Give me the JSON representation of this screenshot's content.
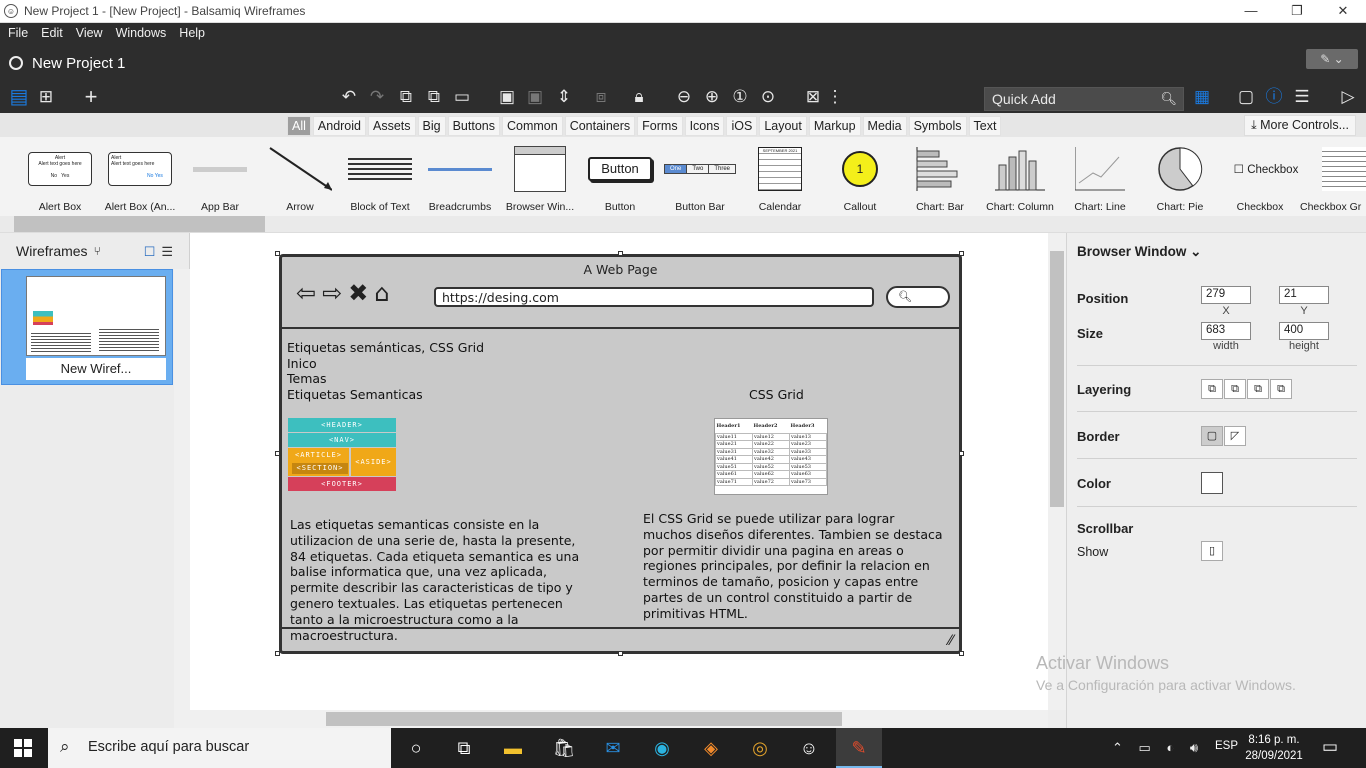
{
  "window": {
    "title": "New Project 1 - [New Project] - Balsamiq Wireframes",
    "controls": [
      "—",
      "❐",
      "✕"
    ]
  },
  "menu": [
    "File",
    "Edit",
    "View",
    "Windows",
    "Help"
  ],
  "project": {
    "name": "New Project 1"
  },
  "quick_add": {
    "placeholder": "Quick Add"
  },
  "categories": [
    "All",
    "Android",
    "Assets",
    "Big",
    "Buttons",
    "Common",
    "Containers",
    "Forms",
    "Icons",
    "iOS",
    "Layout",
    "Markup",
    "Media",
    "Symbols",
    "Text"
  ],
  "active_category": "All",
  "more_controls": "More Controls...",
  "library": [
    "Alert Box",
    "Alert Box (An...",
    "App Bar",
    "Arrow",
    "Block of Text",
    "Breadcrumbs",
    "Browser Win...",
    "Button",
    "Button Bar",
    "Calendar",
    "Callout",
    "Chart: Bar",
    "Chart: Column",
    "Chart: Line",
    "Chart: Pie",
    "Checkbox",
    "Checkbox Gr"
  ],
  "library_previews": {
    "alert_title": "Alert",
    "alert_text": "Alert text goes here",
    "alert_no": "No",
    "alert_yes": "Yes",
    "button_text": "Button",
    "button_bar": [
      "One",
      "Two",
      "Three"
    ],
    "callout_number": "1",
    "checkbox_text": "Checkbox",
    "calendar_month": "SEPTEMBER 2021"
  },
  "left_panel": {
    "title": "Wireframes",
    "page_name": "New Wiref..."
  },
  "mockup": {
    "page_title": "A Web Page",
    "url": "https://desing.com",
    "lines": [
      "Etiquetas semánticas, CSS Grid",
      "Inico",
      "Temas",
      "Etiquetas Semanticas"
    ],
    "css_grid_heading": "CSS Grid",
    "semantic_blocks": [
      "<HEADER>",
      "<NAV>",
      "<ARTICLE>",
      "<SECTION>",
      "<ASIDE>",
      "<FOOTER>"
    ],
    "grid_headers": [
      "Header1",
      "Header2",
      "Header3"
    ],
    "grid_rows": [
      [
        "value11",
        "value12",
        "value13"
      ],
      [
        "value21",
        "value22",
        "value23"
      ],
      [
        "value31",
        "value32",
        "value33"
      ],
      [
        "value41",
        "value42",
        "value43"
      ],
      [
        "value51",
        "value52",
        "value53"
      ],
      [
        "value61",
        "value62",
        "value63"
      ],
      [
        "value71",
        "value72",
        "value73"
      ]
    ],
    "left_paragraph": "Las etiquetas semanticas consiste en la utilizacion de una serie de, hasta la presente, 84 etiquetas. Cada etiqueta semantica es una balise informatica que, una vez aplicada, permite describir las caracteristicas de tipo y genero textuales. Las etiquetas pertenecen tanto a la microestructura como a la macroestructura.",
    "right_paragraph": "El CSS Grid se puede utilizar para lograr muchos diseños diferentes. Tambien se destaca por permitir dividir una pagina en areas o regiones principales, por definir la relacion en terminos de tamaño, posicion y capas entre partes de un control constituido a partir de primitivas HTML."
  },
  "properties": {
    "title": "Browser Window",
    "position_label": "Position",
    "x": "279",
    "y": "21",
    "x_label": "X",
    "y_label": "Y",
    "size_label": "Size",
    "width": "683",
    "height": "400",
    "width_label": "width",
    "height_label": "height",
    "layering_label": "Layering",
    "border_label": "Border",
    "color_label": "Color",
    "scrollbar_label": "Scrollbar",
    "scrollbar_show": "Show"
  },
  "activation": {
    "title": "Activar Windows",
    "subtitle": "Ve a Configuración para activar Windows."
  },
  "taskbar": {
    "search_placeholder": "Escribe aquí para buscar",
    "language": "ESP",
    "time": "8:16 p. m.",
    "date": "28/09/2021"
  },
  "colors": {
    "header_bg": "#2d2d2d",
    "accent_blue": "#1a7ae0",
    "sem_teal": "#3dbfbf",
    "sem_orange": "#f0a818",
    "sem_red": "#d6405a",
    "callout_yellow": "#f4ef1a"
  }
}
